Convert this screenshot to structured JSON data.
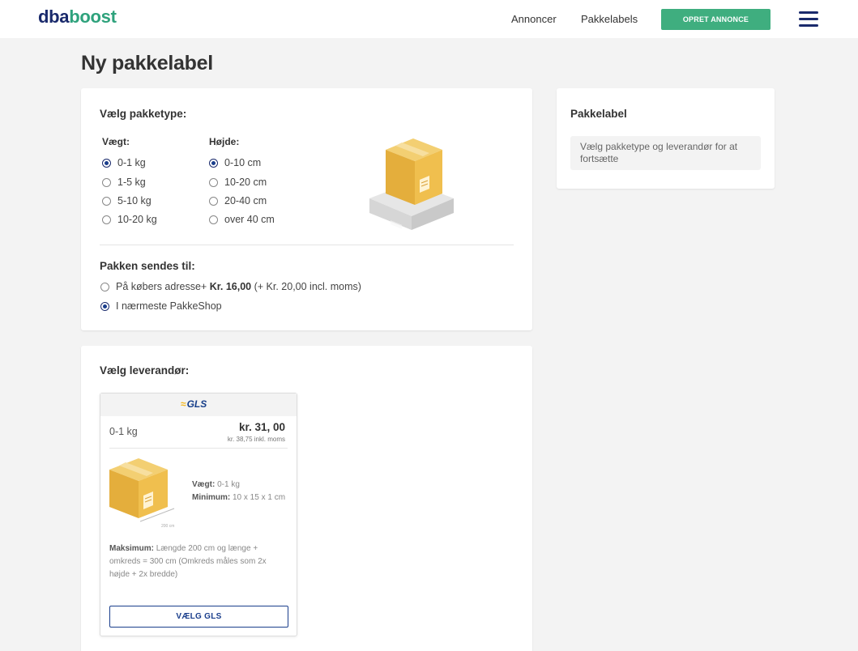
{
  "brand": {
    "part1": "dba",
    "part2": "boost"
  },
  "nav": {
    "annoncer": "Annoncer",
    "pakkelabels": "Pakkelabels",
    "opret": "OPRET ANNONCE"
  },
  "page_title": "Ny pakkelabel",
  "package_type": {
    "heading": "Vælg pakketype:",
    "weight_label": "Vægt:",
    "weights": [
      "0-1 kg",
      "1-5 kg",
      "5-10 kg",
      "10-20 kg"
    ],
    "height_label": "Højde:",
    "heights": [
      "0-10 cm",
      "10-20 cm",
      "20-40 cm",
      "over 40 cm"
    ],
    "selected_weight": "0-1 kg",
    "selected_height": "0-10 cm"
  },
  "destination": {
    "heading": "Pakken sendes til:",
    "option1_text": "På købers adresse+ ",
    "option1_price": "Kr. 16,00",
    "option1_note": " (+ Kr. 20,00 incl. moms)",
    "option2_text": "I nærmeste PakkeShop",
    "selected": "I nærmeste PakkeShop"
  },
  "label_panel": {
    "heading": "Pakkelabel",
    "info": "Vælg pakketype og leverandør for at fortsætte"
  },
  "vendor": {
    "heading": "Vælg leverandør:",
    "name": "GLS",
    "weight": "0-1 kg",
    "price": "kr. 31, 00",
    "price_incl": "kr. 38,75 inkl. moms",
    "spec_weight_label": "Vægt:",
    "spec_weight": " 0-1 kg",
    "spec_min_label": "Minimum:",
    "spec_min": " 10 x 15 x 1 cm",
    "max_label": "Maksimum:",
    "max_text": " Længde 200 cm og længe + omkreds = 300 cm (Omkreds måles som 2x højde + 2x bredde)",
    "box_dim": "200 cm",
    "button": "VÆLG GLS"
  },
  "colors": {
    "navy": "#1a2a6c",
    "green": "#3fae7f",
    "box": "#f0c050"
  },
  "icons": [
    "menu-icon",
    "package-scale-icon",
    "package-box-icon",
    "gls-logo"
  ]
}
